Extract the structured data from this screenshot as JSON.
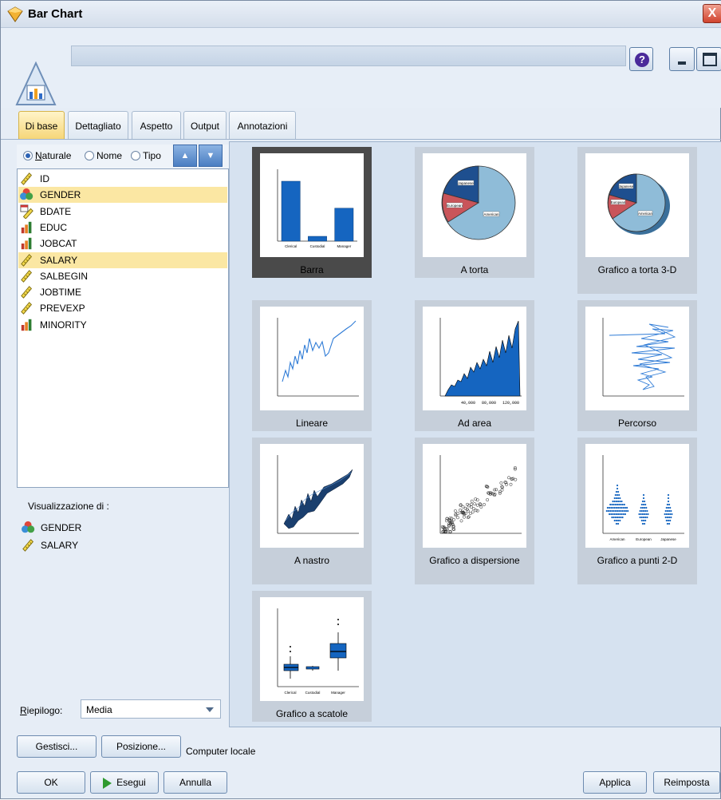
{
  "window": {
    "title": "Bar Chart",
    "close_glyph": "X"
  },
  "header": {
    "help_glyph": "?"
  },
  "tabs": [
    {
      "label": "Di base",
      "active": true
    },
    {
      "label": "Dettagliato",
      "active": false
    },
    {
      "label": "Aspetto",
      "active": false
    },
    {
      "label": "Output",
      "active": false
    },
    {
      "label": "Annotazioni",
      "active": false
    }
  ],
  "sort": {
    "options": [
      "Naturale",
      "Nome",
      "Tipo"
    ],
    "selected": "Naturale",
    "asc_glyph": "▲",
    "desc_glyph": "▼"
  },
  "fields": [
    {
      "name": "ID",
      "icon": "ruler-continuous-icon",
      "selected": false
    },
    {
      "name": "GENDER",
      "icon": "nominal-venn-icon",
      "selected": true
    },
    {
      "name": "BDATE",
      "icon": "date-ruler-icon",
      "selected": false
    },
    {
      "name": "EDUC",
      "icon": "ordinal-bar-icon",
      "selected": false
    },
    {
      "name": "JOBCAT",
      "icon": "ordinal-bar-icon",
      "selected": false
    },
    {
      "name": "SALARY",
      "icon": "ruler-continuous-icon",
      "selected": true
    },
    {
      "name": "SALBEGIN",
      "icon": "ruler-continuous-icon",
      "selected": false
    },
    {
      "name": "JOBTIME",
      "icon": "ruler-continuous-icon",
      "selected": false
    },
    {
      "name": "PREVEXP",
      "icon": "ruler-continuous-icon",
      "selected": false
    },
    {
      "name": "MINORITY",
      "icon": "ordinal-bar-icon",
      "selected": false
    }
  ],
  "display": {
    "label": "Visualizzazione di :",
    "items": [
      {
        "name": "GENDER",
        "icon": "nominal-venn-icon"
      },
      {
        "name": "SALARY",
        "icon": "ruler-continuous-icon"
      }
    ]
  },
  "summary": {
    "label": "Riepilogo:",
    "value": "Media"
  },
  "gallery": [
    {
      "label": "Barra",
      "selected": true
    },
    {
      "label": "A torta",
      "selected": false
    },
    {
      "label": "Grafico a torta 3-D",
      "selected": false
    },
    {
      "label": "Lineare",
      "selected": false
    },
    {
      "label": "Ad area",
      "selected": false
    },
    {
      "label": "Percorso",
      "selected": false
    },
    {
      "label": "A nastro",
      "selected": false
    },
    {
      "label": "Grafico a dispersione",
      "selected": false
    },
    {
      "label": "Grafico a punti 2-D",
      "selected": false
    },
    {
      "label": "Grafico a scatole",
      "selected": false
    }
  ],
  "thumbnails": {
    "bar": {
      "categories": [
        "Clerical",
        "Custodial",
        "Manager"
      ],
      "values": [
        100,
        8,
        55
      ],
      "ylim": [
        0,
        120
      ]
    },
    "pie": {
      "slices": [
        "Japanese",
        "European",
        "American"
      ]
    },
    "pie3d": {
      "slices": [
        "Japanese",
        "European",
        "American"
      ]
    },
    "area": {
      "x_ticks": [
        "40,000",
        "80,000",
        "120,000"
      ]
    },
    "dots": {
      "categories": [
        "American",
        "European",
        "Japanese"
      ]
    },
    "box": {
      "categories": [
        "Clerical",
        "Custodial",
        "Manager"
      ]
    }
  },
  "buttons": {
    "manage": "Gestisci...",
    "position": "Posizione...",
    "location_label": "Computer locale",
    "ok": "OK",
    "run": "Esegui",
    "cancel": "Annulla",
    "apply": "Applica",
    "reset": "Reimposta"
  },
  "colors": {
    "accent": "#1565c0",
    "selected_row": "#fbe7a3",
    "active_tab": "#f6d679"
  }
}
